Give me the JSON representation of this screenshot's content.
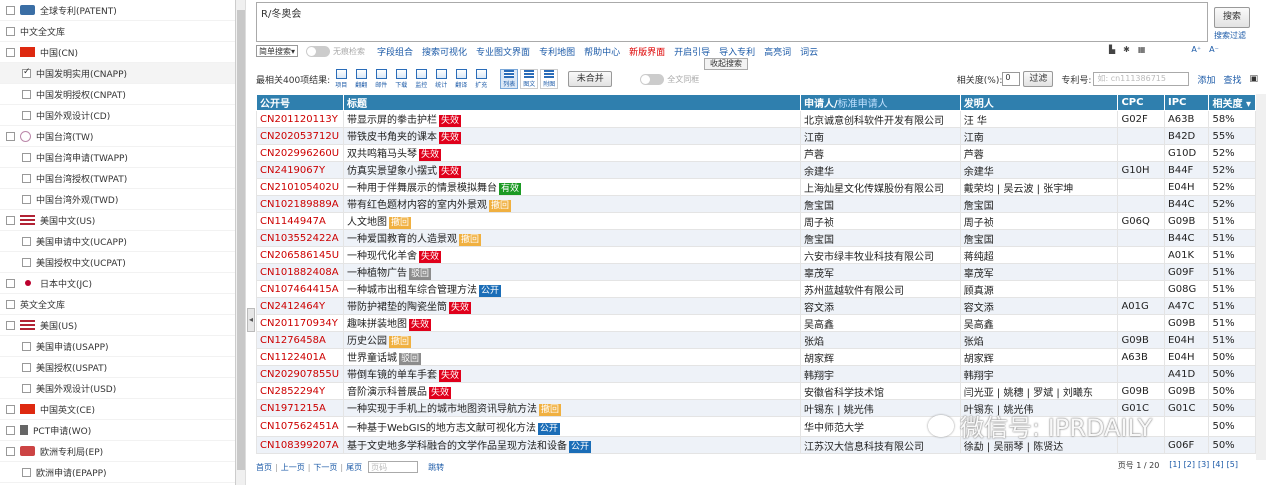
{
  "sidebar": {
    "items": [
      {
        "label": "全球专利(PATENT)",
        "level": "l0",
        "flag": "globe",
        "checked": false
      },
      {
        "label": "中文全文库",
        "level": "l0",
        "flag": "",
        "checked": false
      },
      {
        "label": "中国(CN)",
        "level": "l1",
        "flag": "cn",
        "checked": false
      },
      {
        "label": "中国发明实用(CNAPP)",
        "level": "l2",
        "flag": "",
        "checked": true
      },
      {
        "label": "中国发明授权(CNPAT)",
        "level": "l2",
        "flag": "",
        "checked": false
      },
      {
        "label": "中国外观设计(CD)",
        "level": "l2",
        "flag": "",
        "checked": false
      },
      {
        "label": "中国台湾(TW)",
        "level": "l1",
        "flag": "tw",
        "checked": false
      },
      {
        "label": "中国台湾申请(TWAPP)",
        "level": "l2",
        "flag": "",
        "checked": false
      },
      {
        "label": "中国台湾授权(TWPAT)",
        "level": "l2",
        "flag": "",
        "checked": false
      },
      {
        "label": "中国台湾外观(TWD)",
        "level": "l2",
        "flag": "",
        "checked": false
      },
      {
        "label": "美国中文(US)",
        "level": "l1",
        "flag": "us",
        "checked": false
      },
      {
        "label": "美国申请中文(UCAPP)",
        "level": "l2",
        "flag": "",
        "checked": false
      },
      {
        "label": "美国授权中文(UCPAT)",
        "level": "l2",
        "flag": "",
        "checked": false
      },
      {
        "label": "日本中文(JC)",
        "level": "l1",
        "flag": "jp",
        "checked": false
      },
      {
        "label": "英文全文库",
        "level": "l0",
        "flag": "",
        "checked": false
      },
      {
        "label": "美国(US)",
        "level": "l1",
        "flag": "us",
        "checked": false
      },
      {
        "label": "美国申请(USAPP)",
        "level": "l2",
        "flag": "",
        "checked": false
      },
      {
        "label": "美国授权(USPAT)",
        "level": "l2",
        "flag": "",
        "checked": false
      },
      {
        "label": "美国外观设计(USD)",
        "level": "l2",
        "flag": "",
        "checked": false
      },
      {
        "label": "中国英文(CE)",
        "level": "l1",
        "flag": "cn",
        "checked": false
      },
      {
        "label": "PCT申请(WO)",
        "level": "l1",
        "flag": "wo",
        "checked": false
      },
      {
        "label": "欧洲专利局(EP)",
        "level": "l1",
        "flag": "ep",
        "checked": false
      },
      {
        "label": "欧洲申请(EPAPP)",
        "level": "l2",
        "flag": "",
        "checked": false
      }
    ]
  },
  "search": {
    "query": "R/冬奥会",
    "button": "搜索",
    "filter_link": "搜索过滤",
    "mode_select": "简单搜索",
    "toggle_label": "无痕检索",
    "collapse_label": "收起搜索"
  },
  "toolbar": {
    "links": [
      {
        "label": "字段组合",
        "red": false
      },
      {
        "label": "搜索可视化",
        "red": false
      },
      {
        "label": "专业图文界面",
        "red": false
      },
      {
        "label": "专利地图",
        "red": false
      },
      {
        "label": "帮助中心",
        "red": false
      },
      {
        "label": "新版界面",
        "red": true
      },
      {
        "label": "开启引导",
        "red": false
      },
      {
        "label": "导入专利",
        "red": false
      },
      {
        "label": "高亮词",
        "red": false
      },
      {
        "label": "词云",
        "red": false
      }
    ],
    "font_up": "A⁺",
    "font_down": "A⁻"
  },
  "results": {
    "summary": "最相关400项结果:",
    "icons": [
      "项目",
      "翻翻",
      "邮件",
      "下载",
      "监控",
      "统计",
      "翻译",
      "扩充"
    ],
    "views": [
      "列表",
      "图文",
      "附图"
    ],
    "merge_label": "未合并",
    "fulltext_toggle": "全文同框",
    "relevance_label": "相关度(%):",
    "relevance_value": "0",
    "filter_label": "过滤",
    "patno_label": "专利号:",
    "patno_placeholder": "如: cn111386715",
    "add_label": "添加",
    "find_label": "查找"
  },
  "table": {
    "headers": {
      "pn": "公开号",
      "title": "标题",
      "applicant": "申请人/",
      "applicant_sub": "标准申请人",
      "inventor": "发明人",
      "cpc": "CPC",
      "ipc": "IPC",
      "relevance": "相关度"
    },
    "rows": [
      {
        "pn": "CN201120113Y",
        "title": "带显示屏的拳击护栏",
        "status": "失效",
        "status_class": "b-red",
        "applicant": "北京诚意创科软件开发有限公司",
        "inventor": "汪 华",
        "cpc": "G02F",
        "ipc": "A63B",
        "rel": "58%"
      },
      {
        "pn": "CN202053712U",
        "title": "带铁皮书角夹的课本",
        "status": "失效",
        "status_class": "b-red",
        "applicant": "江南",
        "inventor": "江南",
        "cpc": "",
        "ipc": "B42D",
        "rel": "55%"
      },
      {
        "pn": "CN202996260U",
        "title": "双共鸣箱马头琴",
        "status": "失效",
        "status_class": "b-red",
        "applicant": "芦蓉",
        "inventor": "芦蓉",
        "cpc": "",
        "ipc": "G10D",
        "rel": "52%"
      },
      {
        "pn": "CN2419067Y",
        "title": "仿真实景望象小摆式",
        "status": "失效",
        "status_class": "b-red",
        "applicant": "余建华",
        "inventor": "余建华",
        "cpc": "G10H",
        "ipc": "B44F",
        "rel": "52%"
      },
      {
        "pn": "CN210105402U",
        "title": "一种用于伴舞展示的情景模拟舞台",
        "status": "有效",
        "status_class": "b-green",
        "applicant": "上海灿星文化传媒股份有限公司",
        "inventor": "戴荣均 | 吴云波 | 张宇坤",
        "cpc": "",
        "ipc": "E04H",
        "rel": "52%"
      },
      {
        "pn": "CN102189889A",
        "title": "带有红色题材内容的室内外景观",
        "status": "撤回",
        "status_class": "b-orange",
        "applicant": "詹宝国",
        "inventor": "詹宝国",
        "cpc": "",
        "ipc": "B44C",
        "rel": "52%"
      },
      {
        "pn": "CN1144947A",
        "title": "人文地图",
        "status": "撤回",
        "status_class": "b-orange",
        "applicant": "周子祯",
        "inventor": "周子祯",
        "cpc": "G06Q",
        "ipc": "G09B",
        "rel": "51%"
      },
      {
        "pn": "CN103552422A",
        "title": "一种爱国教育的人造景观",
        "status": "撤回",
        "status_class": "b-orange",
        "applicant": "詹宝国",
        "inventor": "詹宝国",
        "cpc": "",
        "ipc": "B44C",
        "rel": "51%"
      },
      {
        "pn": "CN206586145U",
        "title": "一种现代化羊舍",
        "status": "失效",
        "status_class": "b-red",
        "applicant": "六安市绿丰牧业科技有限公司",
        "inventor": "蒋纯超",
        "cpc": "",
        "ipc": "A01K",
        "rel": "51%"
      },
      {
        "pn": "CN101882408A",
        "title": "一种植物广告",
        "status": "驳回",
        "status_class": "b-grey",
        "applicant": "辜茂军",
        "inventor": "辜茂军",
        "cpc": "",
        "ipc": "G09F",
        "rel": "51%"
      },
      {
        "pn": "CN107464415A",
        "title": "一种城市出租车综合管理方法",
        "status": "公开",
        "status_class": "b-blue",
        "applicant": "苏州蓝越软件有限公司",
        "inventor": "顾真源",
        "cpc": "",
        "ipc": "G08G",
        "rel": "51%"
      },
      {
        "pn": "CN2412464Y",
        "title": "带防护裙垫的陶瓷坐筒",
        "status": "失效",
        "status_class": "b-red",
        "applicant": "容文添",
        "inventor": "容文添",
        "cpc": "A01G",
        "ipc": "A47C",
        "rel": "51%"
      },
      {
        "pn": "CN201170934Y",
        "title": "趣味拼装地图",
        "status": "失效",
        "status_class": "b-red",
        "applicant": "吴高鑫",
        "inventor": "吴高鑫",
        "cpc": "",
        "ipc": "G09B",
        "rel": "51%"
      },
      {
        "pn": "CN1276458A",
        "title": "历史公园",
        "status": "撤回",
        "status_class": "b-orange",
        "applicant": "张焰",
        "inventor": "张焰",
        "cpc": "G09B",
        "ipc": "E04H",
        "rel": "51%"
      },
      {
        "pn": "CN1122401A",
        "title": "世界童话城",
        "status": "驳回",
        "status_class": "b-grey",
        "applicant": "胡家辉",
        "inventor": "胡家辉",
        "cpc": "A63B",
        "ipc": "E04H",
        "rel": "50%"
      },
      {
        "pn": "CN202907855U",
        "title": "带倒车镜的单车手套",
        "status": "失效",
        "status_class": "b-red",
        "applicant": "韩翔宇",
        "inventor": "韩翔宇",
        "cpc": "",
        "ipc": "A41D",
        "rel": "50%"
      },
      {
        "pn": "CN2852294Y",
        "title": "音阶演示科普展品",
        "status": "失效",
        "status_class": "b-red",
        "applicant": "安徽省科学技术馆",
        "inventor": "闫光亚 | 姚穗 | 罗斌 | 刘曦东",
        "cpc": "G09B",
        "ipc": "G09B",
        "rel": "50%"
      },
      {
        "pn": "CN1971215A",
        "title": "一种实现于手机上的城市地图资讯导航方法",
        "status": "撤回",
        "status_class": "b-orange",
        "applicant": "叶锡东 | 姚光伟",
        "inventor": "叶锡东 | 姚光伟",
        "cpc": "G01C",
        "ipc": "G01C",
        "rel": "50%"
      },
      {
        "pn": "CN107562451A",
        "title": "一种基于WebGIS的地方志文献可视化方法",
        "status": "公开",
        "status_class": "b-blue",
        "applicant": "华中师范大学",
        "inventor": "",
        "cpc": "",
        "ipc": "",
        "rel": "50%"
      },
      {
        "pn": "CN108399207A",
        "title": "基于文史地多学科融合的文学作品呈现方法和设备",
        "status": "公开",
        "status_class": "b-blue",
        "applicant": "江苏汉大信息科技有限公司",
        "inventor": "徐勐 | 吴丽琴 | 陈贤达",
        "cpc": "",
        "ipc": "G06F",
        "rel": "50%"
      }
    ]
  },
  "pager": {
    "first": "首页",
    "prev": "上一页",
    "next": "下一页",
    "last": "尾页",
    "input_placeholder": "页码",
    "jump": "跳转",
    "page_info": "页号 1 / 20",
    "pages": [
      "[1]",
      "[2]",
      "[3]",
      "[4]",
      "[5]"
    ]
  },
  "watermark": "微信号: IPRDAILY"
}
